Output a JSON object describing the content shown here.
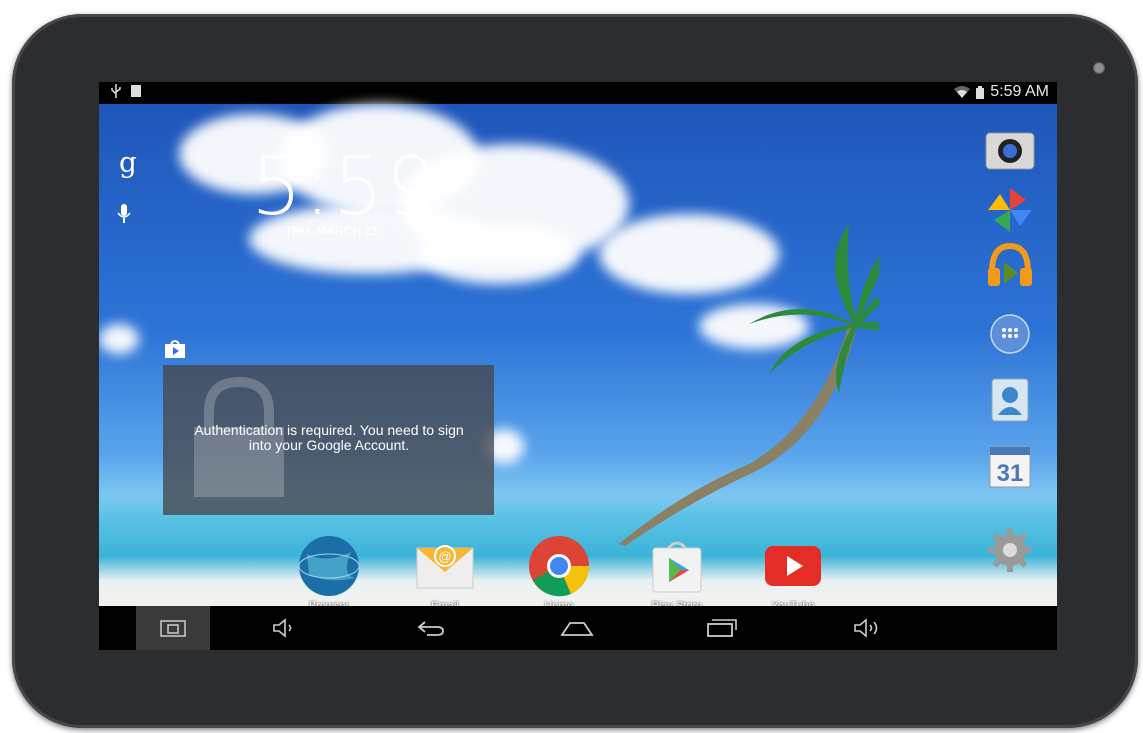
{
  "status": {
    "time": "5:59 AM"
  },
  "home": {
    "clock": "5:59",
    "date": "THU, MARCH 12",
    "search_glyph": "g"
  },
  "notification": {
    "message": "Authentication is required. You need to sign into your Google Account."
  },
  "dock": [
    {
      "label": "Browser",
      "icon": "browser-globe-icon"
    },
    {
      "label": "Email",
      "icon": "email-envelope-icon"
    },
    {
      "label": "Home",
      "icon": "chrome-icon"
    },
    {
      "label": "Play Store",
      "icon": "play-store-icon"
    },
    {
      "label": "YouTube",
      "icon": "youtube-icon"
    }
  ],
  "right_shortcuts": [
    "camera-icon",
    "photos-icon",
    "music-icon",
    "app-drawer-icon",
    "contacts-icon",
    "calendar-icon",
    "settings-icon"
  ],
  "calendar_day": "31",
  "colors": {
    "bezel": "#2c2d31",
    "youtube": "#e52d27",
    "sky": "#2d73d6"
  }
}
